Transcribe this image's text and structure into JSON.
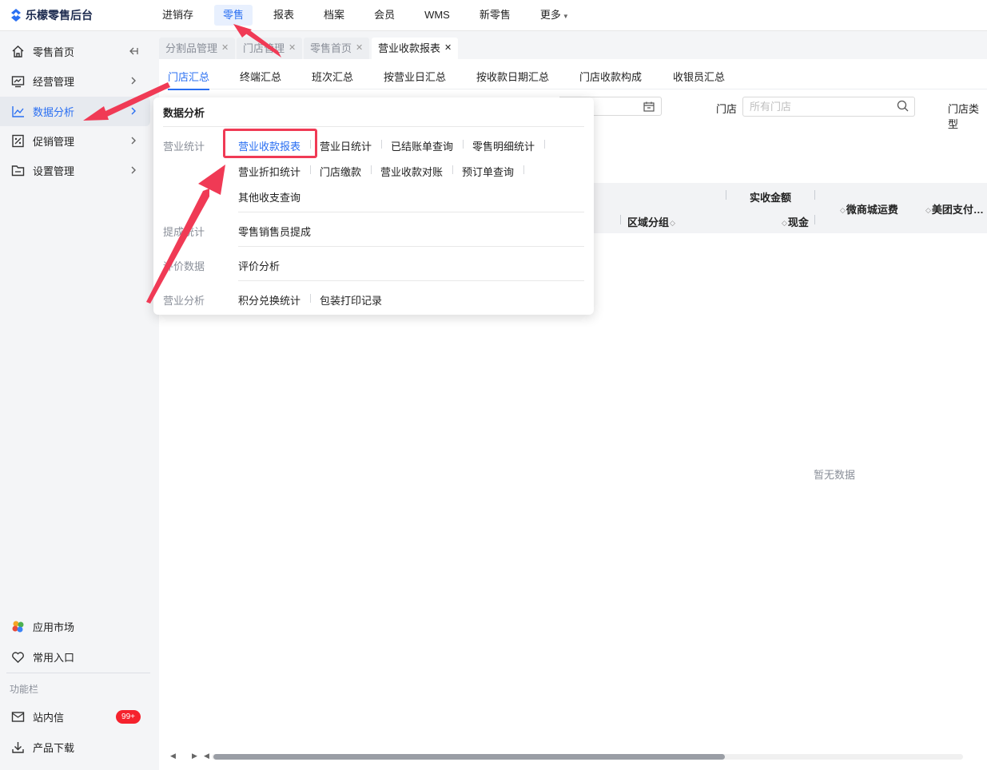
{
  "app": {
    "logo_text": "乐檬零售后台",
    "accent": "#2a6ff2",
    "annotation_color": "#f03a55"
  },
  "topnav": {
    "items": [
      {
        "label": "进销存"
      },
      {
        "label": "零售"
      },
      {
        "label": "报表"
      },
      {
        "label": "档案"
      },
      {
        "label": "会员"
      },
      {
        "label": "WMS"
      },
      {
        "label": "新零售"
      },
      {
        "label": "更多"
      }
    ],
    "active_index": 1
  },
  "sidebar": {
    "items": [
      {
        "label": "零售首页",
        "icon": "home-icon"
      },
      {
        "label": "经营管理",
        "icon": "monitor-icon"
      },
      {
        "label": "数据分析",
        "icon": "line-chart-icon"
      },
      {
        "label": "促销管理",
        "icon": "promo-icon"
      },
      {
        "label": "设置管理",
        "icon": "folder-icon"
      }
    ],
    "active_index": 2,
    "bottom": {
      "app_market": "应用市场",
      "common_entry": "常用入口",
      "section_title": "功能栏",
      "messages": "站内信",
      "messages_badge": "99+",
      "download": "产品下载"
    }
  },
  "tabs": [
    {
      "label": "分割品管理"
    },
    {
      "label": "门店管理"
    },
    {
      "label": "零售首页"
    },
    {
      "label": "营业收款报表"
    }
  ],
  "subtabs": [
    "门店汇总",
    "终端汇总",
    "班次汇总",
    "按营业日汇总",
    "按收款日期汇总",
    "门店收款构成",
    "收银员汇总"
  ],
  "filters": {
    "store_label": "门店",
    "store_placeholder": "所有门店",
    "store_type_label": "门店类型"
  },
  "table": {
    "group_header": "实收金额",
    "col_region": "区域分组",
    "col_cash": "现金",
    "col_weishang": "微商城运费",
    "col_meituan": "美团支付…",
    "empty_text": "暂无数据"
  },
  "panel": {
    "title": "数据分析",
    "groups": [
      {
        "label": "营业统计",
        "links": [
          "营业收款报表",
          "营业日统计",
          "已结账单查询",
          "零售明细统计",
          "营业折扣统计",
          "门店缴款",
          "营业收款对账",
          "预订单查询",
          "其他收支查询"
        ]
      },
      {
        "label": "提成统计",
        "links": [
          "零售销售员提成"
        ]
      },
      {
        "label": "评价数据",
        "links": [
          "评价分析"
        ]
      },
      {
        "label": "营业分析",
        "links": [
          "积分兑换统计",
          "包装打印记录"
        ]
      }
    ]
  }
}
